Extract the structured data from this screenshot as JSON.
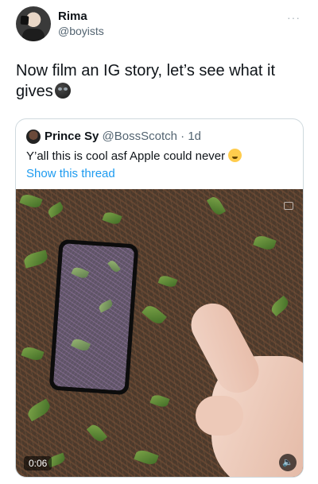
{
  "author": {
    "name": "Rima",
    "handle": "@boyists",
    "more_icon": "ellipsis-icon"
  },
  "tweet": {
    "text": "Now film an IG story, let’s see what it gives",
    "emoji_icon": "emoji-face-icon"
  },
  "quoted": {
    "name": "Prince Sy",
    "handle": "@BossScotch",
    "time": "· 1d",
    "text": "Y’all this is cool asf Apple could never",
    "emoji_icon": "relieved-face-icon",
    "show_thread": "Show this thread",
    "link_color": "#1d9bf0"
  },
  "media": {
    "timer": "0:06",
    "sound_icon": "speaker-mute-icon"
  }
}
